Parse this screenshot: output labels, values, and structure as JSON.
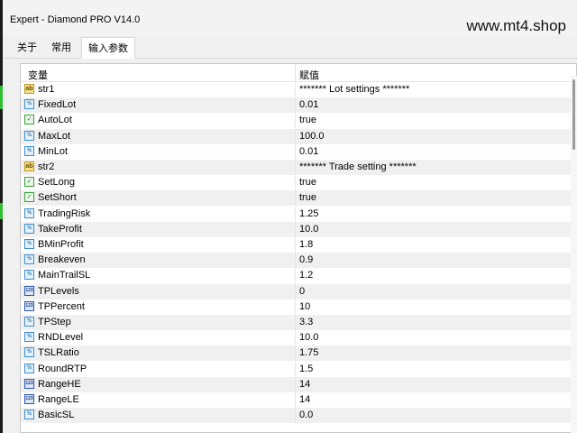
{
  "window": {
    "title": "Expert - Diamond PRO V14.0"
  },
  "watermark": "www.mt4.shop",
  "tabs": [
    {
      "label": "关于",
      "active": false
    },
    {
      "label": "常用",
      "active": false
    },
    {
      "label": "输入参数",
      "active": true
    }
  ],
  "table": {
    "columns": [
      "变量",
      "赋值"
    ],
    "rows": [
      {
        "icon": "string-icon",
        "name": "str1",
        "value": "******* Lot settings *******"
      },
      {
        "icon": "double-icon",
        "name": "FixedLot",
        "value": "0.01"
      },
      {
        "icon": "bool-icon",
        "name": "AutoLot",
        "value": "true"
      },
      {
        "icon": "double-icon",
        "name": "MaxLot",
        "value": "100.0"
      },
      {
        "icon": "double-icon",
        "name": "MinLot",
        "value": "0.01"
      },
      {
        "icon": "string-icon",
        "name": "str2",
        "value": "******* Trade setting *******"
      },
      {
        "icon": "bool-icon",
        "name": "SetLong",
        "value": "true"
      },
      {
        "icon": "bool-icon",
        "name": "SetShort",
        "value": "true"
      },
      {
        "icon": "double-icon",
        "name": "TradingRisk",
        "value": "1.25"
      },
      {
        "icon": "double-icon",
        "name": "TakeProfit",
        "value": "10.0"
      },
      {
        "icon": "double-icon",
        "name": "BMinProfit",
        "value": "1.8"
      },
      {
        "icon": "double-icon",
        "name": "Breakeven",
        "value": "0.9"
      },
      {
        "icon": "double-icon",
        "name": "MainTrailSL",
        "value": "1.2"
      },
      {
        "icon": "int-icon",
        "name": "TPLevels",
        "value": "0"
      },
      {
        "icon": "int-icon",
        "name": "TPPercent",
        "value": "10"
      },
      {
        "icon": "double-icon",
        "name": "TPStep",
        "value": "3.3"
      },
      {
        "icon": "double-icon",
        "name": "RNDLevel",
        "value": "10.0"
      },
      {
        "icon": "double-icon",
        "name": "TSLRatio",
        "value": "1.75"
      },
      {
        "icon": "double-icon",
        "name": "RoundRTP",
        "value": "1.5"
      },
      {
        "icon": "int-icon",
        "name": "RangeHE",
        "value": "14"
      },
      {
        "icon": "int-icon",
        "name": "RangeLE",
        "value": "14"
      },
      {
        "icon": "double-icon",
        "name": "BasicSL",
        "value": "0.0"
      }
    ]
  },
  "icon_glyphs": {
    "string-icon": "ab",
    "double-icon": "½",
    "bool-icon": "✓",
    "int-icon": "123"
  },
  "colors": {
    "row_alt": "#f0f0f0",
    "grid_bg": "#ffffff",
    "window_bg": "#f0f0f0"
  }
}
